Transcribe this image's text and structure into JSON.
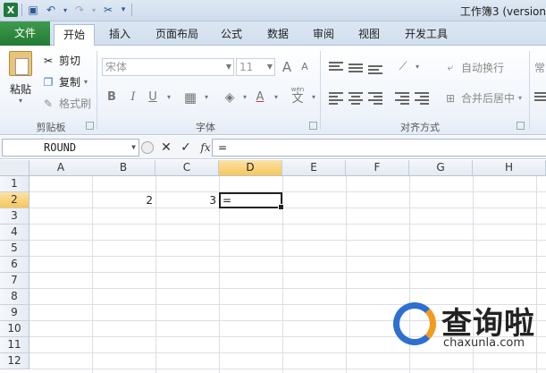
{
  "window": {
    "title": "工作簿3 (version"
  },
  "tabs": {
    "file": "文件",
    "home": "开始",
    "insert": "插入",
    "page_layout": "页面布局",
    "formulas": "公式",
    "data": "数据",
    "review": "审阅",
    "view": "视图",
    "developer": "开发工具"
  },
  "clipboard": {
    "paste": "粘贴",
    "cut": "剪切",
    "copy": "复制",
    "format_painter": "格式刷",
    "label": "剪贴板"
  },
  "font": {
    "name": "宋体",
    "size": "11",
    "label": "字体",
    "bold": "B",
    "italic": "I",
    "underline": "U",
    "grow": "A",
    "shrink": "A",
    "color": "A",
    "wen": "wén"
  },
  "alignment": {
    "wrap": "自动换行",
    "merge": "合并后居中",
    "label": "对齐方式"
  },
  "number": {
    "partial": "常"
  },
  "formula_bar": {
    "name_box": "ROUND",
    "fx": "fx",
    "content": "="
  },
  "grid": {
    "columns": [
      "A",
      "B",
      "C",
      "D",
      "E",
      "F",
      "G",
      "H"
    ],
    "rows": [
      "1",
      "2",
      "3",
      "4",
      "5",
      "6",
      "7",
      "8",
      "9",
      "10",
      "11",
      "12"
    ],
    "cells": {
      "B2": "2",
      "C2": "3",
      "D2": "="
    },
    "active_cell": "D2"
  },
  "watermark": {
    "chinese": "查询啦",
    "url": "chaxunla.com"
  },
  "colors": {
    "file_tab": "#237a35",
    "selected_header": "#f6c75b",
    "accent": "#2b5797"
  }
}
